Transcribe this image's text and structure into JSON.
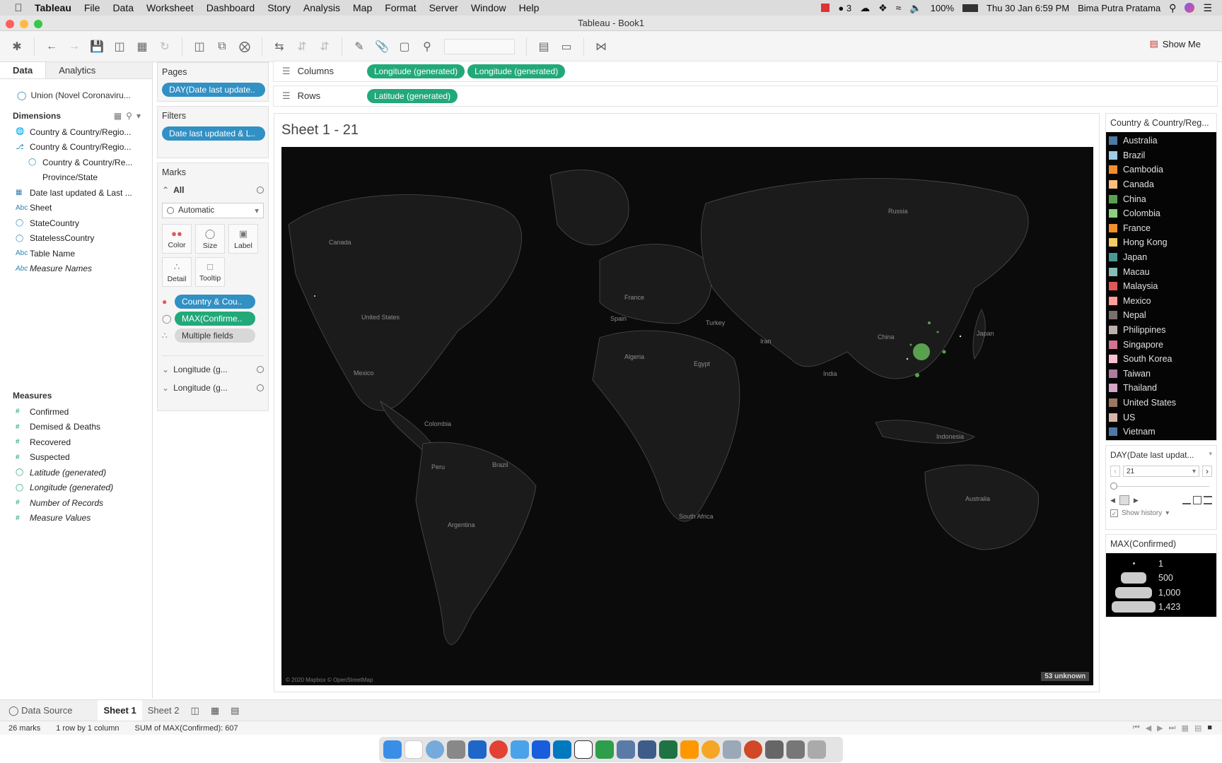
{
  "menubar": {
    "app": "Tableau",
    "items": [
      "File",
      "Data",
      "Worksheet",
      "Dashboard",
      "Story",
      "Analysis",
      "Map",
      "Format",
      "Server",
      "Window",
      "Help"
    ],
    "status": {
      "badge": "3",
      "battery": "100%",
      "datetime": "Thu 30 Jan  6:59 PM",
      "user": "Bima Putra Pratama"
    }
  },
  "window": {
    "title": "Tableau - Book1"
  },
  "toolbar": {
    "show_me": "Show Me"
  },
  "left_panel": {
    "tabs": [
      "Data",
      "Analytics"
    ],
    "datasource": "Union (Novel Coronaviru...",
    "dimensions_title": "Dimensions",
    "dimensions": [
      {
        "icon": "globe-hierarchy",
        "label": "Country & Country/Regio..."
      },
      {
        "icon": "hierarchy",
        "label": "Country & Country/Regio..."
      },
      {
        "icon": "globe",
        "label": "Country & Country/Re..."
      },
      {
        "icon": "text",
        "label": "Province/State"
      },
      {
        "icon": "date",
        "label": "Date last updated & Last ..."
      },
      {
        "icon": "abc",
        "label": "Sheet"
      },
      {
        "icon": "globe",
        "label": "StateCountry"
      },
      {
        "icon": "globe",
        "label": "StatelessCountry"
      },
      {
        "icon": "abc",
        "label": "Table Name"
      },
      {
        "icon": "abc",
        "label": "Measure Names"
      }
    ],
    "measures_title": "Measures",
    "measures": [
      {
        "icon": "#",
        "label": "Confirmed"
      },
      {
        "icon": "#",
        "label": "Demised & Deaths"
      },
      {
        "icon": "#",
        "label": "Recovered"
      },
      {
        "icon": "#",
        "label": "Suspected"
      },
      {
        "icon": "globe",
        "label": "Latitude (generated)"
      },
      {
        "icon": "globe",
        "label": "Longitude (generated)"
      },
      {
        "icon": "#",
        "label": "Number of Records"
      },
      {
        "icon": "#",
        "label": "Measure Values"
      }
    ]
  },
  "pages": {
    "title": "Pages",
    "pill": "DAY(Date last update.."
  },
  "filters": {
    "title": "Filters",
    "pill": "Date last updated & L.."
  },
  "marks": {
    "title": "Marks",
    "all": "All",
    "type": "Automatic",
    "buttons": [
      "Color",
      "Size",
      "Label",
      "Detail",
      "Tooltip"
    ],
    "pills": [
      "Country & Cou..",
      "MAX(Confirme..",
      "Multiple fields"
    ],
    "sub": [
      "Longitude (g...",
      "Longitude (g..."
    ]
  },
  "shelves": {
    "columns_label": "Columns",
    "columns": [
      "Longitude (generated)",
      "Longitude (generated)"
    ],
    "rows_label": "Rows",
    "rows": [
      "Latitude (generated)"
    ]
  },
  "sheet": {
    "title": "Sheet 1 - 21",
    "attribution": "© 2020 Mapbox © OpenStreetMap",
    "unknown": "53 unknown",
    "labels": [
      "Canada",
      "Russia",
      "United States",
      "Mexico",
      "France",
      "Spain",
      "Turkey",
      "Iran",
      "China",
      "Japan",
      "Algeria",
      "Egypt",
      "India",
      "Colombia",
      "Brazil",
      "Peru",
      "Argentina",
      "South Africa",
      "Indonesia",
      "Australia"
    ]
  },
  "color_legend": {
    "title": "Country & Country/Reg...",
    "items": [
      {
        "label": "Australia",
        "color": "#4e79a7"
      },
      {
        "label": "Brazil",
        "color": "#a0cbe8"
      },
      {
        "label": "Cambodia",
        "color": "#f28e2b"
      },
      {
        "label": "Canada",
        "color": "#ffbe7d"
      },
      {
        "label": "China",
        "color": "#59a14f"
      },
      {
        "label": "Colombia",
        "color": "#8cd17d"
      },
      {
        "label": "France",
        "color": "#f28e2b"
      },
      {
        "label": "Hong Kong",
        "color": "#f1ce63"
      },
      {
        "label": "Japan",
        "color": "#499894"
      },
      {
        "label": "Macau",
        "color": "#86bcb6"
      },
      {
        "label": "Malaysia",
        "color": "#e15759"
      },
      {
        "label": "Mexico",
        "color": "#ff9d9a"
      },
      {
        "label": "Nepal",
        "color": "#79706e"
      },
      {
        "label": "Philippines",
        "color": "#bab0ac"
      },
      {
        "label": "Singapore",
        "color": "#d37295"
      },
      {
        "label": "South Korea",
        "color": "#fabfd2"
      },
      {
        "label": "Taiwan",
        "color": "#b07aa1"
      },
      {
        "label": "Thailand",
        "color": "#d4a6c8"
      },
      {
        "label": "United States",
        "color": "#9d7660"
      },
      {
        "label": "US",
        "color": "#d7b5a6"
      },
      {
        "label": "Vietnam",
        "color": "#4e79a7"
      }
    ]
  },
  "page_control": {
    "title": "DAY(Date last updat...",
    "value": "21",
    "show_history": "Show history"
  },
  "size_legend": {
    "title": "MAX(Confirmed)",
    "values": [
      "1",
      "500",
      "1,000",
      "1,423"
    ]
  },
  "bottom_tabs": {
    "data_source": "Data Source",
    "sheets": [
      "Sheet 1",
      "Sheet 2"
    ]
  },
  "status": {
    "marks": "26 marks",
    "dims": "1 row by 1 column",
    "sum": "SUM of MAX(Confirmed): 607"
  }
}
